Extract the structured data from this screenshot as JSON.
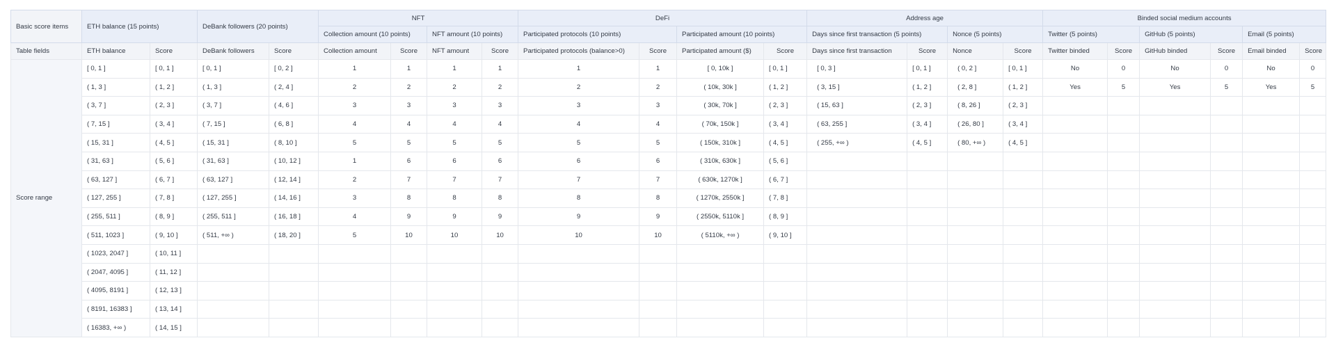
{
  "header": {
    "basic_items": "Basic score items",
    "eth": "ETH balance (15 points)",
    "debank": "DeBank followers (20 points)",
    "nft": "NFT",
    "defi": "DeFi",
    "address_age": "Address age",
    "social": "Binded social medium accounts",
    "collection_amount": "Collection amount (10 points)",
    "nft_amount": "NFT amount (10 points)",
    "participated_protocols": "Participated protocols (10 points)",
    "participated_amount": "Participated amount (10 points)",
    "days_since": "Days since first transaction (5 points)",
    "nonce": "Nonce (5 points)",
    "twitter": "Twitter (5 points)",
    "github": "GitHub (5 points)",
    "email": "Email (5 points)"
  },
  "fields": {
    "label": "Table fields",
    "cols": [
      "ETH balance",
      "Score",
      "DeBank followers",
      "Score",
      "Collection amount",
      "Score",
      "NFT amount",
      "Score",
      "Participated protocols (balance>0)",
      "Score",
      "Participated amount ($)",
      "Score",
      "Days since first transaction",
      "Score",
      "Nonce",
      "Score",
      "Twitter binded",
      "Score",
      "GitHub binded",
      "Score",
      "Email binded",
      "Score"
    ]
  },
  "score_range_label": "Score range",
  "rows": [
    [
      "[ 0, 1 ]",
      "[ 0, 1 ]",
      "[ 0, 1 ]",
      "[ 0, 2 ]",
      "1",
      "1",
      "1",
      "1",
      "1",
      "1",
      "[ 0, 10k ]",
      "[ 0, 1 ]",
      "[ 0, 3 ]",
      "[ 0, 1 ]",
      "( 0, 2 ]",
      "[ 0, 1 ]",
      "No",
      "0",
      "No",
      "0",
      "No",
      "0"
    ],
    [
      "( 1, 3 ]",
      "( 1, 2 ]",
      "( 1, 3 ]",
      "( 2, 4 ]",
      "2",
      "2",
      "2",
      "2",
      "2",
      "2",
      "( 10k, 30k ]",
      "( 1, 2 ]",
      "( 3, 15 ]",
      "( 1, 2 ]",
      "( 2, 8 ]",
      "( 1, 2 ]",
      "Yes",
      "5",
      "Yes",
      "5",
      "Yes",
      "5"
    ],
    [
      "( 3, 7 ]",
      "( 2, 3 ]",
      "( 3, 7 ]",
      "( 4, 6 ]",
      "3",
      "3",
      "3",
      "3",
      "3",
      "3",
      "( 30k, 70k ]",
      "( 2, 3 ]",
      "( 15, 63 ]",
      "( 2, 3 ]",
      "( 8, 26 ]",
      "( 2, 3 ]",
      "",
      "",
      "",
      "",
      "",
      ""
    ],
    [
      "( 7, 15 ]",
      "( 3, 4 ]",
      "( 7, 15 ]",
      "( 6, 8 ]",
      "4",
      "4",
      "4",
      "4",
      "4",
      "4",
      "( 70k, 150k ]",
      "( 3, 4 ]",
      "( 63, 255 ]",
      "( 3, 4 ]",
      "( 26, 80 ]",
      "( 3, 4 ]",
      "",
      "",
      "",
      "",
      "",
      ""
    ],
    [
      "( 15, 31 ]",
      "( 4, 5 ]",
      "( 15, 31 ]",
      "( 8, 10 ]",
      "5",
      "5",
      "5",
      "5",
      "5",
      "5",
      "( 150k, 310k ]",
      "( 4, 5 ]",
      "( 255, +∞ )",
      "( 4, 5 ]",
      "( 80, +∞ )",
      "( 4, 5 ]",
      "",
      "",
      "",
      "",
      "",
      ""
    ],
    [
      "( 31, 63 ]",
      "( 5, 6 ]",
      "( 31, 63 ]",
      "( 10, 12 ]",
      "1",
      "6",
      "6",
      "6",
      "6",
      "6",
      "( 310k, 630k ]",
      "( 5, 6 ]",
      "",
      "",
      "",
      "",
      "",
      "",
      "",
      "",
      "",
      ""
    ],
    [
      "( 63, 127 ]",
      "( 6, 7 ]",
      "( 63, 127 ]",
      "( 12, 14 ]",
      "2",
      "7",
      "7",
      "7",
      "7",
      "7",
      "( 630k, 1270k ]",
      "( 6, 7 ]",
      "",
      "",
      "",
      "",
      "",
      "",
      "",
      "",
      "",
      ""
    ],
    [
      "( 127, 255 ]",
      "( 7, 8 ]",
      "( 127, 255 ]",
      "( 14, 16 ]",
      "3",
      "8",
      "8",
      "8",
      "8",
      "8",
      "( 1270k, 2550k ]",
      "( 7, 8 ]",
      "",
      "",
      "",
      "",
      "",
      "",
      "",
      "",
      "",
      ""
    ],
    [
      "( 255, 511 ]",
      "( 8, 9 ]",
      "( 255, 511 ]",
      "( 16, 18 ]",
      "4",
      "9",
      "9",
      "9",
      "9",
      "9",
      "( 2550k, 5110k ]",
      "( 8, 9 ]",
      "",
      "",
      "",
      "",
      "",
      "",
      "",
      "",
      "",
      ""
    ],
    [
      "( 511, 1023 ]",
      "( 9, 10 ]",
      "( 511, +∞ )",
      "( 18, 20 ]",
      "5",
      "10",
      "10",
      "10",
      "10",
      "10",
      "( 5110k, +∞ )",
      "( 9, 10 ]",
      "",
      "",
      "",
      "",
      "",
      "",
      "",
      "",
      "",
      ""
    ],
    [
      "( 1023, 2047 ]",
      "( 10, 11 ]",
      "",
      "",
      "",
      "",
      "",
      "",
      "",
      "",
      "",
      "",
      "",
      "",
      "",
      "",
      "",
      "",
      "",
      "",
      "",
      ""
    ],
    [
      "( 2047, 4095 ]",
      "( 11, 12 ]",
      "",
      "",
      "",
      "",
      "",
      "",
      "",
      "",
      "",
      "",
      "",
      "",
      "",
      "",
      "",
      "",
      "",
      "",
      "",
      ""
    ],
    [
      "( 4095, 8191 ]",
      "( 12, 13 ]",
      "",
      "",
      "",
      "",
      "",
      "",
      "",
      "",
      "",
      "",
      "",
      "",
      "",
      "",
      "",
      "",
      "",
      "",
      "",
      ""
    ],
    [
      "( 8191, 16383 ]",
      "( 13, 14 ]",
      "",
      "",
      "",
      "",
      "",
      "",
      "",
      "",
      "",
      "",
      "",
      "",
      "",
      "",
      "",
      "",
      "",
      "",
      "",
      ""
    ],
    [
      "( 16383, +∞ )",
      "( 14, 15 ]",
      "",
      "",
      "",
      "",
      "",
      "",
      "",
      "",
      "",
      "",
      "",
      "",
      "",
      "",
      "",
      "",
      "",
      "",
      "",
      ""
    ]
  ]
}
